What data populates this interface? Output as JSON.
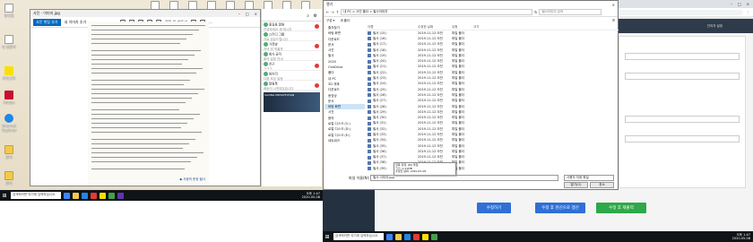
{
  "left_screen": {
    "desktop_icons": [
      {
        "label": "휴지통",
        "kind": "file"
      },
      {
        "label": "내 컴퓨터",
        "kind": "file"
      },
      {
        "label": "카카오톡",
        "kind": "kakao"
      },
      {
        "label": "Adobe",
        "kind": "adobe"
      },
      {
        "label": "Internet Explorer",
        "kind": "ie"
      },
      {
        "label": "폴더",
        "kind": "folder"
      },
      {
        "label": "폴더",
        "kind": "folder"
      }
    ],
    "top_icons": [
      "문서",
      "문서",
      "문서",
      "문서",
      "문서",
      "문서",
      "문서",
      "문서",
      "문서"
    ],
    "viewer": {
      "title": "사진 - 이미지.jpg",
      "open_button": "사진 편집 추가",
      "toolbar_link": "내 이미지 추가",
      "toolbar_extra": "편집 및 만들기"
    },
    "note_lines": 30,
    "note_footer": "◆ 사랑의 문장 필사",
    "chat_panel": {
      "rows": [
        {
          "name": "홍길동 알림",
          "preview": "안녕하세요 새 메시지",
          "badge": true
        },
        {
          "name": "스터디 그룹",
          "preview": "자료 공유드립니다",
          "badge": false
        },
        {
          "name": "가족방",
          "preview": "저녁 뭐 먹을까",
          "badge": true
        },
        {
          "name": "회사 공지",
          "preview": "회의 일정 안내",
          "badge": false
        },
        {
          "name": "친구",
          "preview": "ㅋㅋㅋ",
          "badge": true
        },
        {
          "name": "동아리",
          "preview": "다음 모임 일정",
          "badge": false
        },
        {
          "name": "알림톡",
          "preview": "배송이 시작되었습니다",
          "badge": true
        }
      ],
      "ad_text": "SAVING PRIVATE RYAN"
    },
    "taskbar": {
      "search_placeholder": "검색하려면 여기에 입력하십시오.",
      "time": "오후 1:47",
      "date": "2020-05-08"
    }
  },
  "right_screen": {
    "browser": {
      "tab_title": "필사 업로드",
      "page_header_user": "관리자 설정"
    },
    "dialog": {
      "title": "열기",
      "breadcrumb": "내 PC > 사진 폴더 > 필사이미지",
      "search_placeholder": "필사이미지 검색",
      "commands": [
        "구성 ▾",
        "새 폴더"
      ],
      "nav_items": [
        "즐겨찾기",
        "바탕 화면",
        "다운로드",
        "문서",
        "사진",
        "필사",
        "2020",
        "OneDrive",
        "폴더",
        "내 PC",
        "3D 개체",
        "다운로드",
        "동영상",
        "문서",
        "바탕 화면",
        "사진",
        "음악",
        "로컬 디스크 (C:)",
        "로컬 디스크 (D:)",
        "로컬 디스크 (E:)",
        "네트워크"
      ],
      "nav_selected_index": 14,
      "columns": [
        "이름",
        "수정한 날짜",
        "유형",
        "크기"
      ],
      "files": [
        {
          "name": "필사 (15)",
          "date": "2019-11-12 오전",
          "type": "파일 폴더"
        },
        {
          "name": "필사 (16)",
          "date": "2019-11-12 오전",
          "type": "파일 폴더"
        },
        {
          "name": "필사 (17)",
          "date": "2019-11-12 오전",
          "type": "파일 폴더"
        },
        {
          "name": "필사 (18)",
          "date": "2019-11-12 오전",
          "type": "파일 폴더"
        },
        {
          "name": "필사 (19)",
          "date": "2019-11-12 오전",
          "type": "파일 폴더"
        },
        {
          "name": "필사 (20)",
          "date": "2019-11-12 오전",
          "type": "파일 폴더"
        },
        {
          "name": "필사 (21)",
          "date": "2019-11-12 오전",
          "type": "파일 폴더"
        },
        {
          "name": "필사 (22)",
          "date": "2019-11-12 오전",
          "type": "파일 폴더"
        },
        {
          "name": "필사 (23)",
          "date": "2019-11-12 오전",
          "type": "파일 폴더"
        },
        {
          "name": "필사 (24)",
          "date": "2019-11-12 오전",
          "type": "파일 폴더"
        },
        {
          "name": "필사 (25)",
          "date": "2019-11-12 오전",
          "type": "파일 폴더"
        },
        {
          "name": "필사 (26)",
          "date": "2019-11-12 오전",
          "type": "파일 폴더"
        },
        {
          "name": "필사 (27)",
          "date": "2019-11-12 오전",
          "type": "파일 폴더"
        },
        {
          "name": "필사 (28)",
          "date": "2019-11-12 오전",
          "type": "파일 폴더"
        },
        {
          "name": "필사 (29)",
          "date": "2019-11-12 오전",
          "type": "파일 폴더"
        },
        {
          "name": "필사 (30)",
          "date": "2019-11-12 오전",
          "type": "파일 폴더"
        },
        {
          "name": "필사 (31)",
          "date": "2019-11-12 오전",
          "type": "파일 폴더"
        },
        {
          "name": "필사 (32)",
          "date": "2019-11-12 오전",
          "type": "파일 폴더"
        },
        {
          "name": "필사 (33)",
          "date": "2019-11-12 오전",
          "type": "파일 폴더"
        },
        {
          "name": "필사 (34)",
          "date": "2019-11-12 오전",
          "type": "파일 폴더"
        },
        {
          "name": "필사 (35)",
          "date": "2019-11-12 오전",
          "type": "파일 폴더"
        },
        {
          "name": "필사 (36)",
          "date": "2019-11-12 오전",
          "type": "파일 폴더"
        },
        {
          "name": "필사 (37)",
          "date": "2019-11-12 오전",
          "type": "파일 폴더"
        },
        {
          "name": "필사 (38)",
          "date": "2019-11-12 오전",
          "type": "파일 폴더"
        },
        {
          "name": "필사 (39)",
          "date": "2019-11-12 오전",
          "type": "파일 폴더"
        }
      ],
      "tooltip_lines": [
        "항목 유형: JPG 파일",
        "크기: 2.21MB",
        "수정한 날짜: 2020-05-08"
      ],
      "filename_label": "파일 이름(N):",
      "filename_value": "필사 이미지.jpg",
      "filetype_value": "사용자 지정 파일",
      "open_button": "열기(O)",
      "cancel_button": "취소"
    },
    "actions": [
      {
        "label": "수정하기",
        "color": "#2f6fd6"
      },
      {
        "label": "수정 후 천신으로 갱신",
        "color": "#2f6fd6"
      },
      {
        "label": "수정 후 재출력",
        "color": "#2ea84a"
      }
    ],
    "taskbar": {
      "search_placeholder": "검색하려면 여기에 입력하십시오.",
      "time": "오후 1:47",
      "date": "2020-05-08"
    }
  }
}
